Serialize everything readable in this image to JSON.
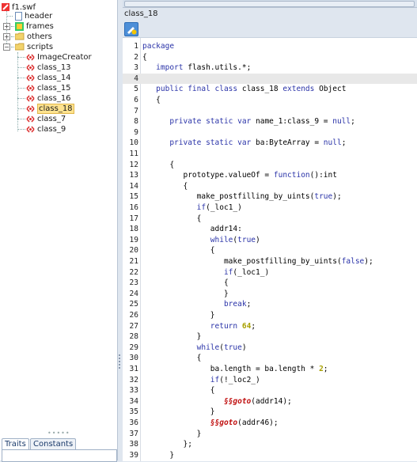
{
  "tree": {
    "root": "f1.swf",
    "items": [
      {
        "label": "header"
      },
      {
        "label": "frames"
      },
      {
        "label": "others"
      },
      {
        "label": "scripts"
      }
    ],
    "scripts": [
      "ImageCreator",
      "class_13",
      "class_14",
      "class_15",
      "class_16",
      "class_18",
      "class_7",
      "class_9"
    ],
    "selected": "class_18"
  },
  "tabs": [
    "Traits",
    "Constants"
  ],
  "editor": {
    "title": "class_18",
    "current_line": 4,
    "lines": [
      {
        "n": "1",
        "t": [
          [
            "package",
            "kw"
          ]
        ]
      },
      {
        "n": "2",
        "t": [
          [
            "{",
            ""
          ]
        ]
      },
      {
        "n": "3",
        "t": [
          [
            "   ",
            ""
          ],
          [
            "import",
            "kw"
          ],
          [
            " flash.utils.*;",
            ""
          ]
        ]
      },
      {
        "n": "4",
        "t": [
          [
            "",
            ""
          ]
        ]
      },
      {
        "n": "5",
        "t": [
          [
            "   ",
            ""
          ],
          [
            "public final class",
            "kw"
          ],
          [
            " class_18 ",
            ""
          ],
          [
            "extends",
            "kw"
          ],
          [
            " Object",
            ""
          ]
        ]
      },
      {
        "n": "6",
        "t": [
          [
            "   {",
            ""
          ]
        ]
      },
      {
        "n": "7",
        "t": [
          [
            "",
            ""
          ]
        ]
      },
      {
        "n": "8",
        "t": [
          [
            "      ",
            ""
          ],
          [
            "private static var",
            "kw"
          ],
          [
            " name_1:class_9 = ",
            ""
          ],
          [
            "null",
            "kw"
          ],
          [
            ";",
            ""
          ]
        ]
      },
      {
        "n": "9",
        "t": [
          [
            "",
            ""
          ]
        ]
      },
      {
        "n": "10",
        "t": [
          [
            "      ",
            ""
          ],
          [
            "private static var",
            "kw"
          ],
          [
            " ba:ByteArray = ",
            ""
          ],
          [
            "null",
            "kw"
          ],
          [
            ";",
            ""
          ]
        ]
      },
      {
        "n": "11",
        "t": [
          [
            "",
            ""
          ]
        ]
      },
      {
        "n": "12",
        "t": [
          [
            "      {",
            ""
          ]
        ]
      },
      {
        "n": "13",
        "t": [
          [
            "         prototype.valueOf = ",
            ""
          ],
          [
            "function",
            "kw"
          ],
          [
            "():int",
            ""
          ]
        ]
      },
      {
        "n": "14",
        "t": [
          [
            "         {",
            ""
          ]
        ]
      },
      {
        "n": "15",
        "t": [
          [
            "            make_postfilling_by_uints(",
            ""
          ],
          [
            "true",
            "kw"
          ],
          [
            ");",
            ""
          ]
        ]
      },
      {
        "n": "16",
        "t": [
          [
            "            ",
            ""
          ],
          [
            "if",
            "kw"
          ],
          [
            "(_loc1_)",
            ""
          ]
        ]
      },
      {
        "n": "17",
        "t": [
          [
            "            {",
            ""
          ]
        ]
      },
      {
        "n": "18",
        "t": [
          [
            "               addr14:",
            ""
          ]
        ]
      },
      {
        "n": "19",
        "t": [
          [
            "               ",
            ""
          ],
          [
            "while",
            "kw"
          ],
          [
            "(",
            ""
          ],
          [
            "true",
            "kw"
          ],
          [
            ")",
            ""
          ]
        ]
      },
      {
        "n": "20",
        "t": [
          [
            "               {",
            ""
          ]
        ]
      },
      {
        "n": "21",
        "t": [
          [
            "                  make_postfilling_by_uints(",
            ""
          ],
          [
            "false",
            "kw"
          ],
          [
            ");",
            ""
          ]
        ]
      },
      {
        "n": "22",
        "t": [
          [
            "                  ",
            ""
          ],
          [
            "if",
            "kw"
          ],
          [
            "(_loc1_)",
            ""
          ]
        ]
      },
      {
        "n": "23",
        "t": [
          [
            "                  {",
            ""
          ]
        ]
      },
      {
        "n": "24",
        "t": [
          [
            "                  }",
            ""
          ]
        ]
      },
      {
        "n": "25",
        "t": [
          [
            "                  ",
            ""
          ],
          [
            "break",
            "kw"
          ],
          [
            ";",
            ""
          ]
        ]
      },
      {
        "n": "26",
        "t": [
          [
            "               }",
            ""
          ]
        ]
      },
      {
        "n": "27",
        "t": [
          [
            "               ",
            ""
          ],
          [
            "return",
            "kw"
          ],
          [
            " ",
            ""
          ],
          [
            "64",
            "num"
          ],
          [
            ";",
            ""
          ]
        ]
      },
      {
        "n": "28",
        "t": [
          [
            "            }",
            ""
          ]
        ]
      },
      {
        "n": "29",
        "t": [
          [
            "            ",
            ""
          ],
          [
            "while",
            "kw"
          ],
          [
            "(",
            ""
          ],
          [
            "true",
            "kw"
          ],
          [
            ")",
            ""
          ]
        ]
      },
      {
        "n": "30",
        "t": [
          [
            "            {",
            ""
          ]
        ]
      },
      {
        "n": "31",
        "t": [
          [
            "               ba.length = ba.length * ",
            ""
          ],
          [
            "2",
            "num"
          ],
          [
            ";",
            ""
          ]
        ]
      },
      {
        "n": "32",
        "t": [
          [
            "               ",
            ""
          ],
          [
            "if",
            "kw"
          ],
          [
            "(!_loc2_)",
            ""
          ]
        ]
      },
      {
        "n": "33",
        "t": [
          [
            "               {",
            ""
          ]
        ]
      },
      {
        "n": "34",
        "t": [
          [
            "                  ",
            ""
          ],
          [
            "§§goto",
            "goto"
          ],
          [
            "(addr14);",
            ""
          ]
        ]
      },
      {
        "n": "35",
        "t": [
          [
            "               }",
            ""
          ]
        ]
      },
      {
        "n": "36",
        "t": [
          [
            "               ",
            ""
          ],
          [
            "§§goto",
            "goto"
          ],
          [
            "(addr46);",
            ""
          ]
        ]
      },
      {
        "n": "37",
        "t": [
          [
            "            }",
            ""
          ]
        ]
      },
      {
        "n": "38",
        "t": [
          [
            "         };",
            ""
          ]
        ]
      },
      {
        "n": "39",
        "t": [
          [
            "      }",
            ""
          ]
        ]
      }
    ]
  },
  "colors": {
    "keyword": "#2a33a8",
    "number": "#a8a000",
    "goto": "#c01010",
    "selection": "#ffe38f"
  }
}
